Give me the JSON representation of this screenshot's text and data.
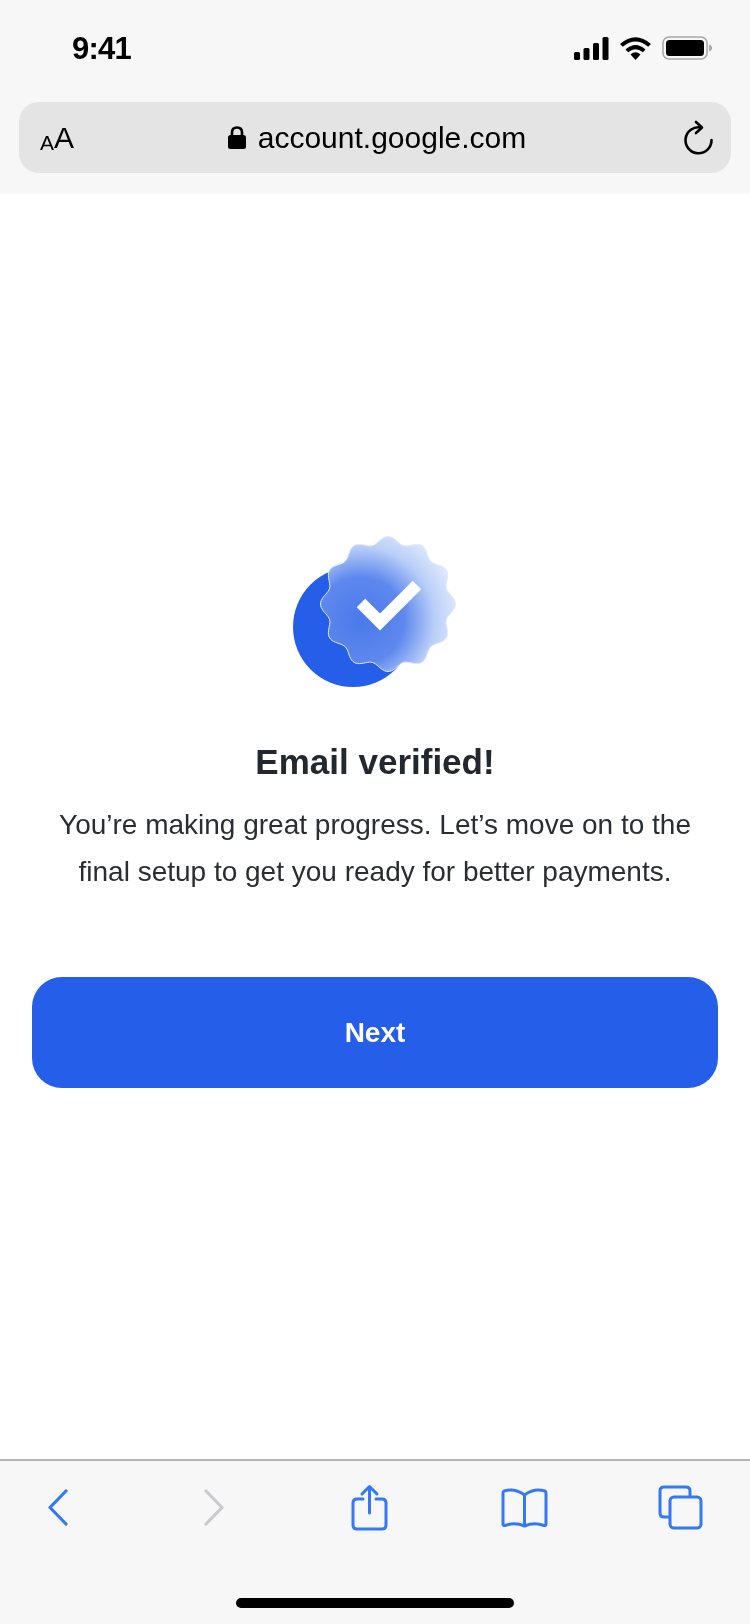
{
  "status_bar": {
    "time": "9:41"
  },
  "address_bar": {
    "reader_button": {
      "small": "A",
      "large": "A"
    },
    "secure": true,
    "url": "account.google.com"
  },
  "content": {
    "title": "Email verified!",
    "message": "You’re making great progress. Let’s move on to the final setup to get you ready for better payments.",
    "button": "Next"
  },
  "toolbar": [
    {
      "kind": "back",
      "disabled": false
    },
    {
      "kind": "forward",
      "disabled": true
    },
    {
      "kind": "share",
      "disabled": false
    },
    {
      "kind": "bookmarks",
      "disabled": false
    },
    {
      "kind": "tabs",
      "disabled": false
    }
  ]
}
